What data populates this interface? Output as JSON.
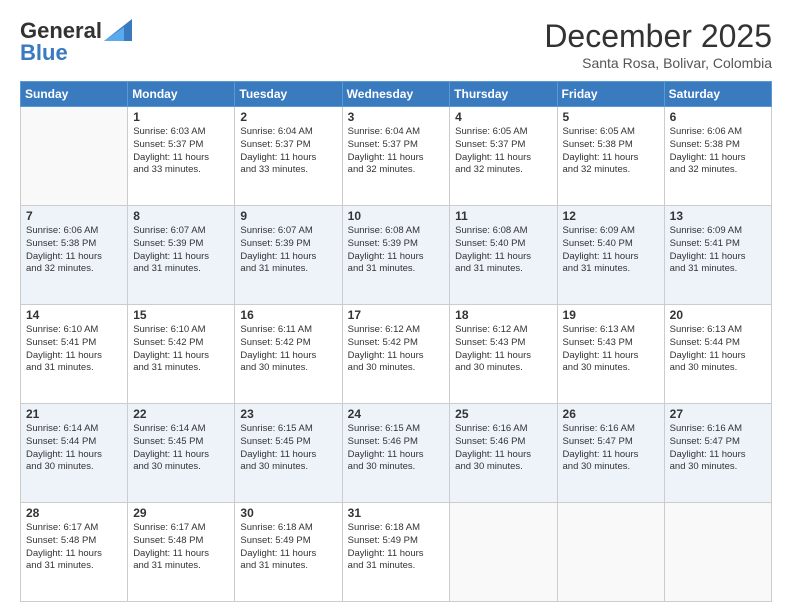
{
  "header": {
    "logo_general": "General",
    "logo_blue": "Blue",
    "month_year": "December 2025",
    "location": "Santa Rosa, Bolivar, Colombia"
  },
  "days_of_week": [
    "Sunday",
    "Monday",
    "Tuesday",
    "Wednesday",
    "Thursday",
    "Friday",
    "Saturday"
  ],
  "weeks": [
    [
      {
        "day": "",
        "sunrise": "",
        "sunset": "",
        "daylight": ""
      },
      {
        "day": "1",
        "sunrise": "Sunrise: 6:03 AM",
        "sunset": "Sunset: 5:37 PM",
        "daylight": "Daylight: 11 hours and 33 minutes."
      },
      {
        "day": "2",
        "sunrise": "Sunrise: 6:04 AM",
        "sunset": "Sunset: 5:37 PM",
        "daylight": "Daylight: 11 hours and 33 minutes."
      },
      {
        "day": "3",
        "sunrise": "Sunrise: 6:04 AM",
        "sunset": "Sunset: 5:37 PM",
        "daylight": "Daylight: 11 hours and 32 minutes."
      },
      {
        "day": "4",
        "sunrise": "Sunrise: 6:05 AM",
        "sunset": "Sunset: 5:37 PM",
        "daylight": "Daylight: 11 hours and 32 minutes."
      },
      {
        "day": "5",
        "sunrise": "Sunrise: 6:05 AM",
        "sunset": "Sunset: 5:38 PM",
        "daylight": "Daylight: 11 hours and 32 minutes."
      },
      {
        "day": "6",
        "sunrise": "Sunrise: 6:06 AM",
        "sunset": "Sunset: 5:38 PM",
        "daylight": "Daylight: 11 hours and 32 minutes."
      }
    ],
    [
      {
        "day": "7",
        "sunrise": "Sunrise: 6:06 AM",
        "sunset": "Sunset: 5:38 PM",
        "daylight": "Daylight: 11 hours and 32 minutes."
      },
      {
        "day": "8",
        "sunrise": "Sunrise: 6:07 AM",
        "sunset": "Sunset: 5:39 PM",
        "daylight": "Daylight: 11 hours and 31 minutes."
      },
      {
        "day": "9",
        "sunrise": "Sunrise: 6:07 AM",
        "sunset": "Sunset: 5:39 PM",
        "daylight": "Daylight: 11 hours and 31 minutes."
      },
      {
        "day": "10",
        "sunrise": "Sunrise: 6:08 AM",
        "sunset": "Sunset: 5:39 PM",
        "daylight": "Daylight: 11 hours and 31 minutes."
      },
      {
        "day": "11",
        "sunrise": "Sunrise: 6:08 AM",
        "sunset": "Sunset: 5:40 PM",
        "daylight": "Daylight: 11 hours and 31 minutes."
      },
      {
        "day": "12",
        "sunrise": "Sunrise: 6:09 AM",
        "sunset": "Sunset: 5:40 PM",
        "daylight": "Daylight: 11 hours and 31 minutes."
      },
      {
        "day": "13",
        "sunrise": "Sunrise: 6:09 AM",
        "sunset": "Sunset: 5:41 PM",
        "daylight": "Daylight: 11 hours and 31 minutes."
      }
    ],
    [
      {
        "day": "14",
        "sunrise": "Sunrise: 6:10 AM",
        "sunset": "Sunset: 5:41 PM",
        "daylight": "Daylight: 11 hours and 31 minutes."
      },
      {
        "day": "15",
        "sunrise": "Sunrise: 6:10 AM",
        "sunset": "Sunset: 5:42 PM",
        "daylight": "Daylight: 11 hours and 31 minutes."
      },
      {
        "day": "16",
        "sunrise": "Sunrise: 6:11 AM",
        "sunset": "Sunset: 5:42 PM",
        "daylight": "Daylight: 11 hours and 30 minutes."
      },
      {
        "day": "17",
        "sunrise": "Sunrise: 6:12 AM",
        "sunset": "Sunset: 5:42 PM",
        "daylight": "Daylight: 11 hours and 30 minutes."
      },
      {
        "day": "18",
        "sunrise": "Sunrise: 6:12 AM",
        "sunset": "Sunset: 5:43 PM",
        "daylight": "Daylight: 11 hours and 30 minutes."
      },
      {
        "day": "19",
        "sunrise": "Sunrise: 6:13 AM",
        "sunset": "Sunset: 5:43 PM",
        "daylight": "Daylight: 11 hours and 30 minutes."
      },
      {
        "day": "20",
        "sunrise": "Sunrise: 6:13 AM",
        "sunset": "Sunset: 5:44 PM",
        "daylight": "Daylight: 11 hours and 30 minutes."
      }
    ],
    [
      {
        "day": "21",
        "sunrise": "Sunrise: 6:14 AM",
        "sunset": "Sunset: 5:44 PM",
        "daylight": "Daylight: 11 hours and 30 minutes."
      },
      {
        "day": "22",
        "sunrise": "Sunrise: 6:14 AM",
        "sunset": "Sunset: 5:45 PM",
        "daylight": "Daylight: 11 hours and 30 minutes."
      },
      {
        "day": "23",
        "sunrise": "Sunrise: 6:15 AM",
        "sunset": "Sunset: 5:45 PM",
        "daylight": "Daylight: 11 hours and 30 minutes."
      },
      {
        "day": "24",
        "sunrise": "Sunrise: 6:15 AM",
        "sunset": "Sunset: 5:46 PM",
        "daylight": "Daylight: 11 hours and 30 minutes."
      },
      {
        "day": "25",
        "sunrise": "Sunrise: 6:16 AM",
        "sunset": "Sunset: 5:46 PM",
        "daylight": "Daylight: 11 hours and 30 minutes."
      },
      {
        "day": "26",
        "sunrise": "Sunrise: 6:16 AM",
        "sunset": "Sunset: 5:47 PM",
        "daylight": "Daylight: 11 hours and 30 minutes."
      },
      {
        "day": "27",
        "sunrise": "Sunrise: 6:16 AM",
        "sunset": "Sunset: 5:47 PM",
        "daylight": "Daylight: 11 hours and 30 minutes."
      }
    ],
    [
      {
        "day": "28",
        "sunrise": "Sunrise: 6:17 AM",
        "sunset": "Sunset: 5:48 PM",
        "daylight": "Daylight: 11 hours and 31 minutes."
      },
      {
        "day": "29",
        "sunrise": "Sunrise: 6:17 AM",
        "sunset": "Sunset: 5:48 PM",
        "daylight": "Daylight: 11 hours and 31 minutes."
      },
      {
        "day": "30",
        "sunrise": "Sunrise: 6:18 AM",
        "sunset": "Sunset: 5:49 PM",
        "daylight": "Daylight: 11 hours and 31 minutes."
      },
      {
        "day": "31",
        "sunrise": "Sunrise: 6:18 AM",
        "sunset": "Sunset: 5:49 PM",
        "daylight": "Daylight: 11 hours and 31 minutes."
      },
      {
        "day": "",
        "sunrise": "",
        "sunset": "",
        "daylight": ""
      },
      {
        "day": "",
        "sunrise": "",
        "sunset": "",
        "daylight": ""
      },
      {
        "day": "",
        "sunrise": "",
        "sunset": "",
        "daylight": ""
      }
    ]
  ]
}
